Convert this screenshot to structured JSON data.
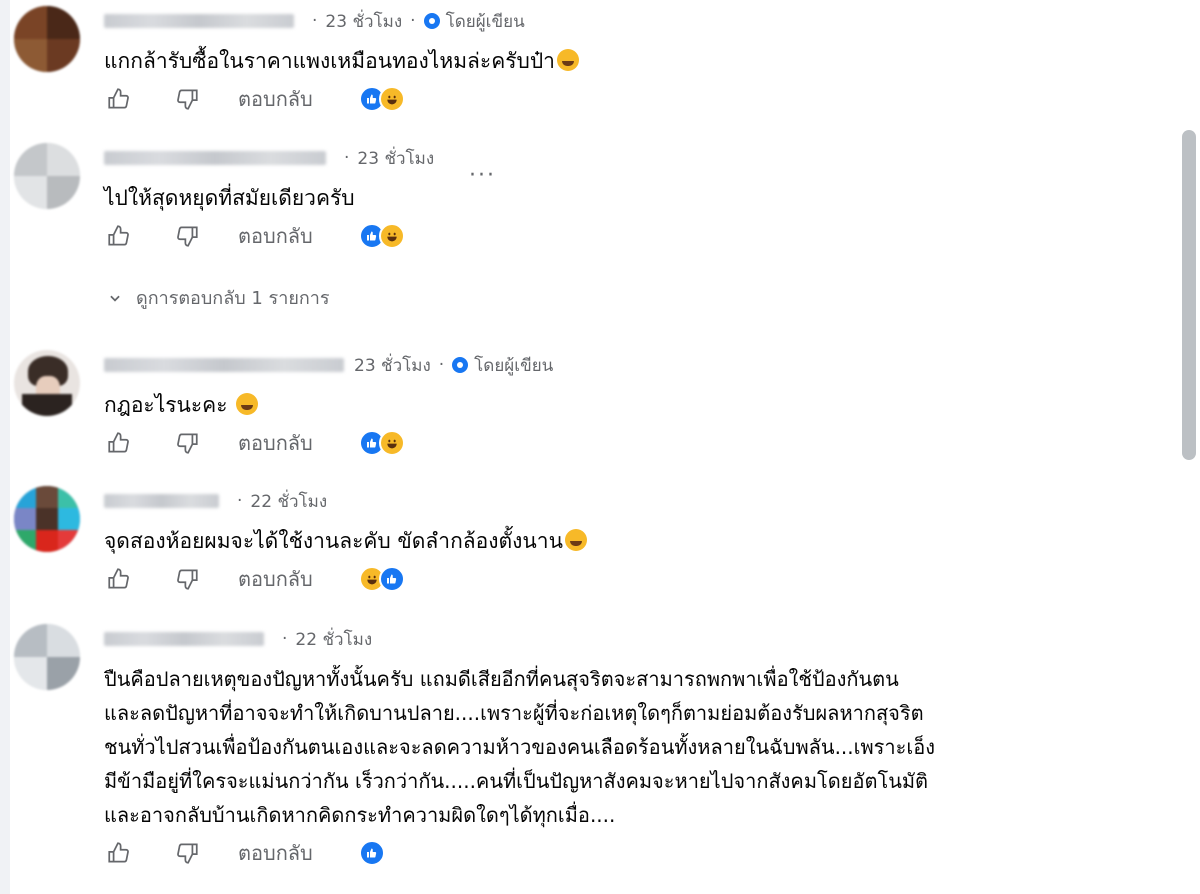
{
  "comments": [
    {
      "time": "23 ชั่วโมง",
      "author_badge": "โดยผู้เขียน",
      "text": "แกกล้ารับซื้อในราคาแพงเหมือนทองไหมล่ะครับป๋า",
      "reply": "ตอบกลับ",
      "reactions": [
        "like",
        "haha"
      ]
    },
    {
      "time": "23 ชั่วโมง",
      "text": "ไปให้สุดหยุดที่สมัยเดียวครับ",
      "more": "···",
      "reply": "ตอบกลับ",
      "reactions": [
        "like",
        "haha"
      ],
      "view_replies": "ดูการตอบกลับ 1 รายการ"
    },
    {
      "time": "23 ชั่วโมง",
      "author_badge": "โดยผู้เขียน",
      "text": "กฎอะไรนะคะ",
      "reply": "ตอบกลับ",
      "reactions": [
        "like",
        "haha"
      ]
    },
    {
      "time": "22 ชั่วโมง",
      "text": "จุดสองห้อยผมจะได้ใช้งานละคับ ขัดลำกล้องตั้งนาน",
      "reply": "ตอบกลับ",
      "reactions": [
        "haha",
        "like"
      ]
    },
    {
      "time": "22 ชั่วโมง",
      "text_lines": [
        "ปืนคือปลายเหตุของปัญหาทั้งนั้นครับ แถมดีเสียอีกที่คนสุจริตจะสามารถพกพาเพื่อใช้ป้องกันตน",
        "และลดปัญหาที่อาจจะทำให้เกิดบานปลาย....เพราะผู้ที่จะก่อเหตุใดๆก็ตามย่อมต้องรับผลหากสุจริต",
        "ชนทั่วไปสวนเพื่อป้องกันตนเองและจะลดความห้าวของคนเลือดร้อนทั้งหลายในฉับพลัน...เพราะเอ็ง",
        "มีข้ามือยู่ที่ใครจะแม่นกว่ากัน เร็วกว่ากัน.....คนที่เป็นปัญหาสังคมจะหายไปจากสังคมโดยอัตโนมัติ",
        "และอาจกลับบ้านเกิดหากคิดกระทำความผิดใดๆได้ทุกเมื่อ...."
      ],
      "reply": "ตอบกลับ",
      "reactions": [
        "like"
      ]
    }
  ],
  "colors": {
    "like": "#1877f2",
    "haha": "#f7b928",
    "muted": "#65676b",
    "text": "#050505"
  },
  "icons": [
    "thumbs-up-icon",
    "thumbs-down-icon",
    "globe-author-icon",
    "chevron-down-icon",
    "more-dots-icon",
    "grin-emoji-icon"
  ]
}
